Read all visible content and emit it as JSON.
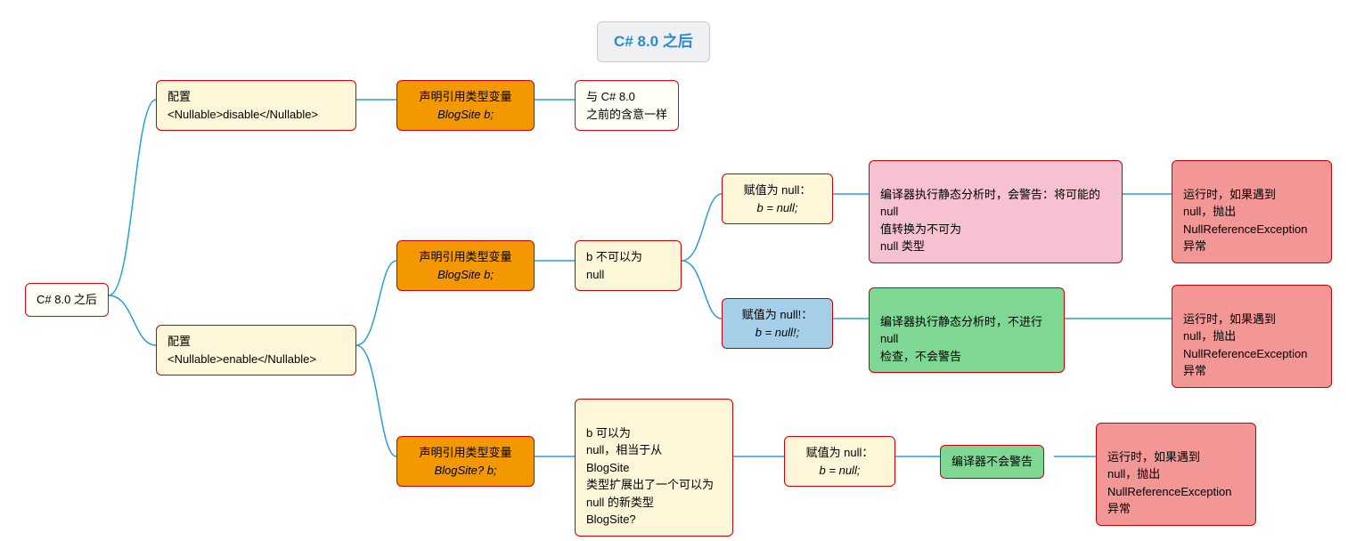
{
  "title": "C# 8.0 之后",
  "root": {
    "label": "C# 8.0 之后"
  },
  "configDisable": {
    "line1": "配置",
    "line2": "<Nullable>disable</Nullable>"
  },
  "configEnable": {
    "line1": "配置",
    "line2": "<Nullable>enable</Nullable>"
  },
  "declA": {
    "line1": "声明引用类型变量",
    "line2": "BlogSite b;"
  },
  "declA_desc": {
    "line1": "与 C# 8.0",
    "line2": "之前的含意一样"
  },
  "declB": {
    "line1": "声明引用类型变量",
    "line2": "BlogSite b;"
  },
  "declB_desc": {
    "line1": "b 不可以为",
    "line2": "null"
  },
  "declC": {
    "line1": "声明引用类型变量",
    "line2": "BlogSite? b;"
  },
  "declC_desc": "b 可以为\nnull，相当于从\nBlogSite\n类型扩展出了一个可以为\nnull 的新类型\nBlogSite?",
  "assignNull1": {
    "line1": "赋值为 null：",
    "line2": "b = null;"
  },
  "assignNullBang": {
    "line1": "赋值为 null!：",
    "line2": "b = null!;"
  },
  "assignNull2": {
    "line1": "赋值为 null：",
    "line2": "b = null;"
  },
  "compilerWarn": "编译器执行静态分析时，会警告：将可能的\nnull\n值转换为不可为\nnull 类型",
  "compilerNoCheck": "编译器执行静态分析时，不进行\nnull\n检查，不会警告",
  "compilerNoWarn": "编译器不会警告",
  "runtimeErr": "运行时，如果遇到\nnull，抛出\nNullReferenceException\n异常"
}
